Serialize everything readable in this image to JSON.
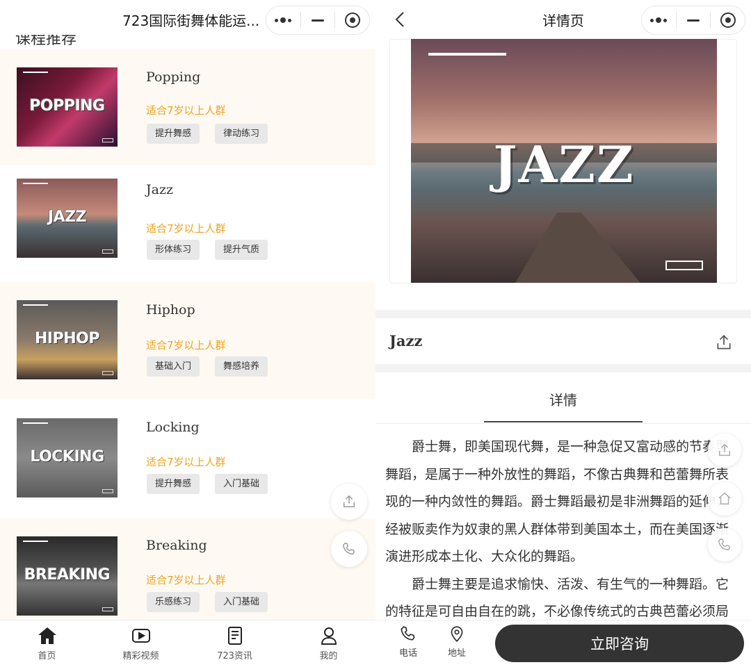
{
  "left": {
    "app_title": "723国际街舞体能运...",
    "section_title": "课程推荐",
    "courses": [
      {
        "name": "Popping",
        "age": "适合7岁以上人群",
        "thumb_word": "POPPING",
        "tags": [
          "提升舞感",
          "律动练习"
        ]
      },
      {
        "name": "Jazz",
        "age": "适合7岁以上人群",
        "thumb_word": "JAZZ",
        "tags": [
          "形体练习",
          "提升气质"
        ]
      },
      {
        "name": "Hiphop",
        "age": "适合7岁以上人群",
        "thumb_word": "HIPHOP",
        "tags": [
          "基础入门",
          "舞感培养"
        ]
      },
      {
        "name": "Locking",
        "age": "适合7岁以上人群",
        "thumb_word": "LOCKING",
        "tags": [
          "提升舞感",
          "入门基础"
        ]
      },
      {
        "name": "Breaking",
        "age": "适合7岁以上人群",
        "thumb_word": "BREAKING",
        "tags": [
          "乐感练习",
          "入门基础"
        ]
      }
    ],
    "tabbar": [
      {
        "label": "首页",
        "icon": "home-icon",
        "active": true
      },
      {
        "label": "精彩视频",
        "icon": "video-icon"
      },
      {
        "label": "723资讯",
        "icon": "news-icon"
      },
      {
        "label": "我的",
        "icon": "user-icon"
      }
    ]
  },
  "right": {
    "nav_title": "详情页",
    "hero_word": "JAZZ",
    "detail_title": "Jazz",
    "detail_tab": "详情",
    "article": [
      "爵士舞，即美国现代舞，是一种急促又富动感的节奏型舞蹈，是属于一种外放性的舞蹈，不像古典舞和芭蕾舞所表现的一种内敛性的舞蹈。爵士舞蹈最初是非洲舞蹈的延伸，经被贩卖作为奴隶的黑人群体带到美国本土，而在美国逐渐演进形成本土化、大众化的舞蹈。",
      "爵士舞主要是追求愉快、活泼、有生气的一种舞蹈。它的特征是可自由自在的跳，不必像传统式的古典芭蕾必须局限于一种形式与遵守固有的姿态。随着美国"
    ],
    "bottom": {
      "phone_label": "电话",
      "address_label": "地址",
      "consult_label": "立即咨询"
    }
  },
  "colors": {
    "accent_orange": "#f0a21d",
    "dark_button": "#333333",
    "shade_row": "#fefaf3"
  }
}
